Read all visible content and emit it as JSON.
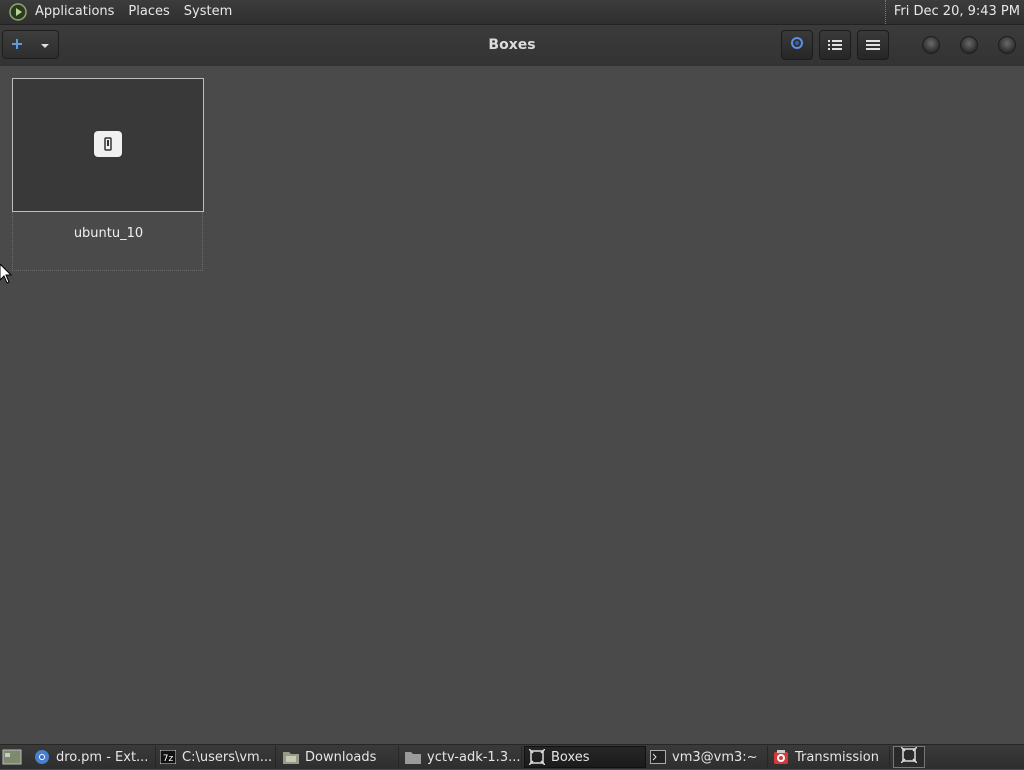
{
  "top_panel": {
    "menus": [
      "Applications",
      "Places",
      "System"
    ],
    "clock": "Fri Dec 20,  9:43 PM"
  },
  "headerbar": {
    "title": "Boxes"
  },
  "content": {
    "vm_name": "ubuntu_10"
  },
  "taskbar": {
    "tasks": [
      {
        "label": "dro.pm - Ext...",
        "icon": "chromium-icon"
      },
      {
        "label": "C:\\users\\vm...",
        "icon": "7zip-icon"
      },
      {
        "label": "Downloads",
        "icon": "folder-icon"
      },
      {
        "label": "yctv-adk-1.3...",
        "icon": "folder-icon"
      },
      {
        "label": "Boxes",
        "icon": "boxes-icon",
        "active": true
      },
      {
        "label": "vm3@vm3:~",
        "icon": "terminal-icon"
      },
      {
        "label": "Transmission",
        "icon": "transmission-icon"
      }
    ]
  },
  "colors": {
    "background": "#4a4a4a",
    "panel": "#333333",
    "accent": "#4a90d9"
  }
}
